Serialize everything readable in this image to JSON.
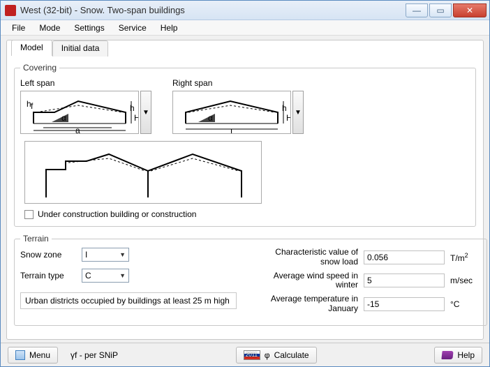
{
  "window": {
    "title": "West (32-bit) - Snow. Two-span buildings"
  },
  "menu": {
    "file": "File",
    "mode": "Mode",
    "settings": "Settings",
    "service": "Service",
    "help": "Help"
  },
  "tabs": {
    "model": "Model",
    "initial": "Initial data"
  },
  "covering": {
    "legend": "Covering",
    "left_label": "Left span",
    "right_label": "Right span"
  },
  "under_construction": {
    "label": "Under construction building or construction",
    "checked": false
  },
  "terrain": {
    "legend": "Terrain",
    "snow_zone_label": "Snow zone",
    "snow_zone_value": "I",
    "terrain_type_label": "Terrain type",
    "terrain_type_value": "C",
    "description": "Urban districts occupied by buildings at least 25 m high",
    "char_label": "Characteristic value of snow load",
    "char_value": "0.056",
    "char_unit_html": "T/m²",
    "wind_label": "Average wind speed in winter",
    "wind_value": "5",
    "wind_unit": "m/sec",
    "temp_label": "Average temperature in January",
    "temp_value": "-15",
    "temp_unit": "°C"
  },
  "status": {
    "menu": "Menu",
    "snip": "γf  - per SNiP",
    "calculate": "Calculate",
    "help": "Help"
  }
}
